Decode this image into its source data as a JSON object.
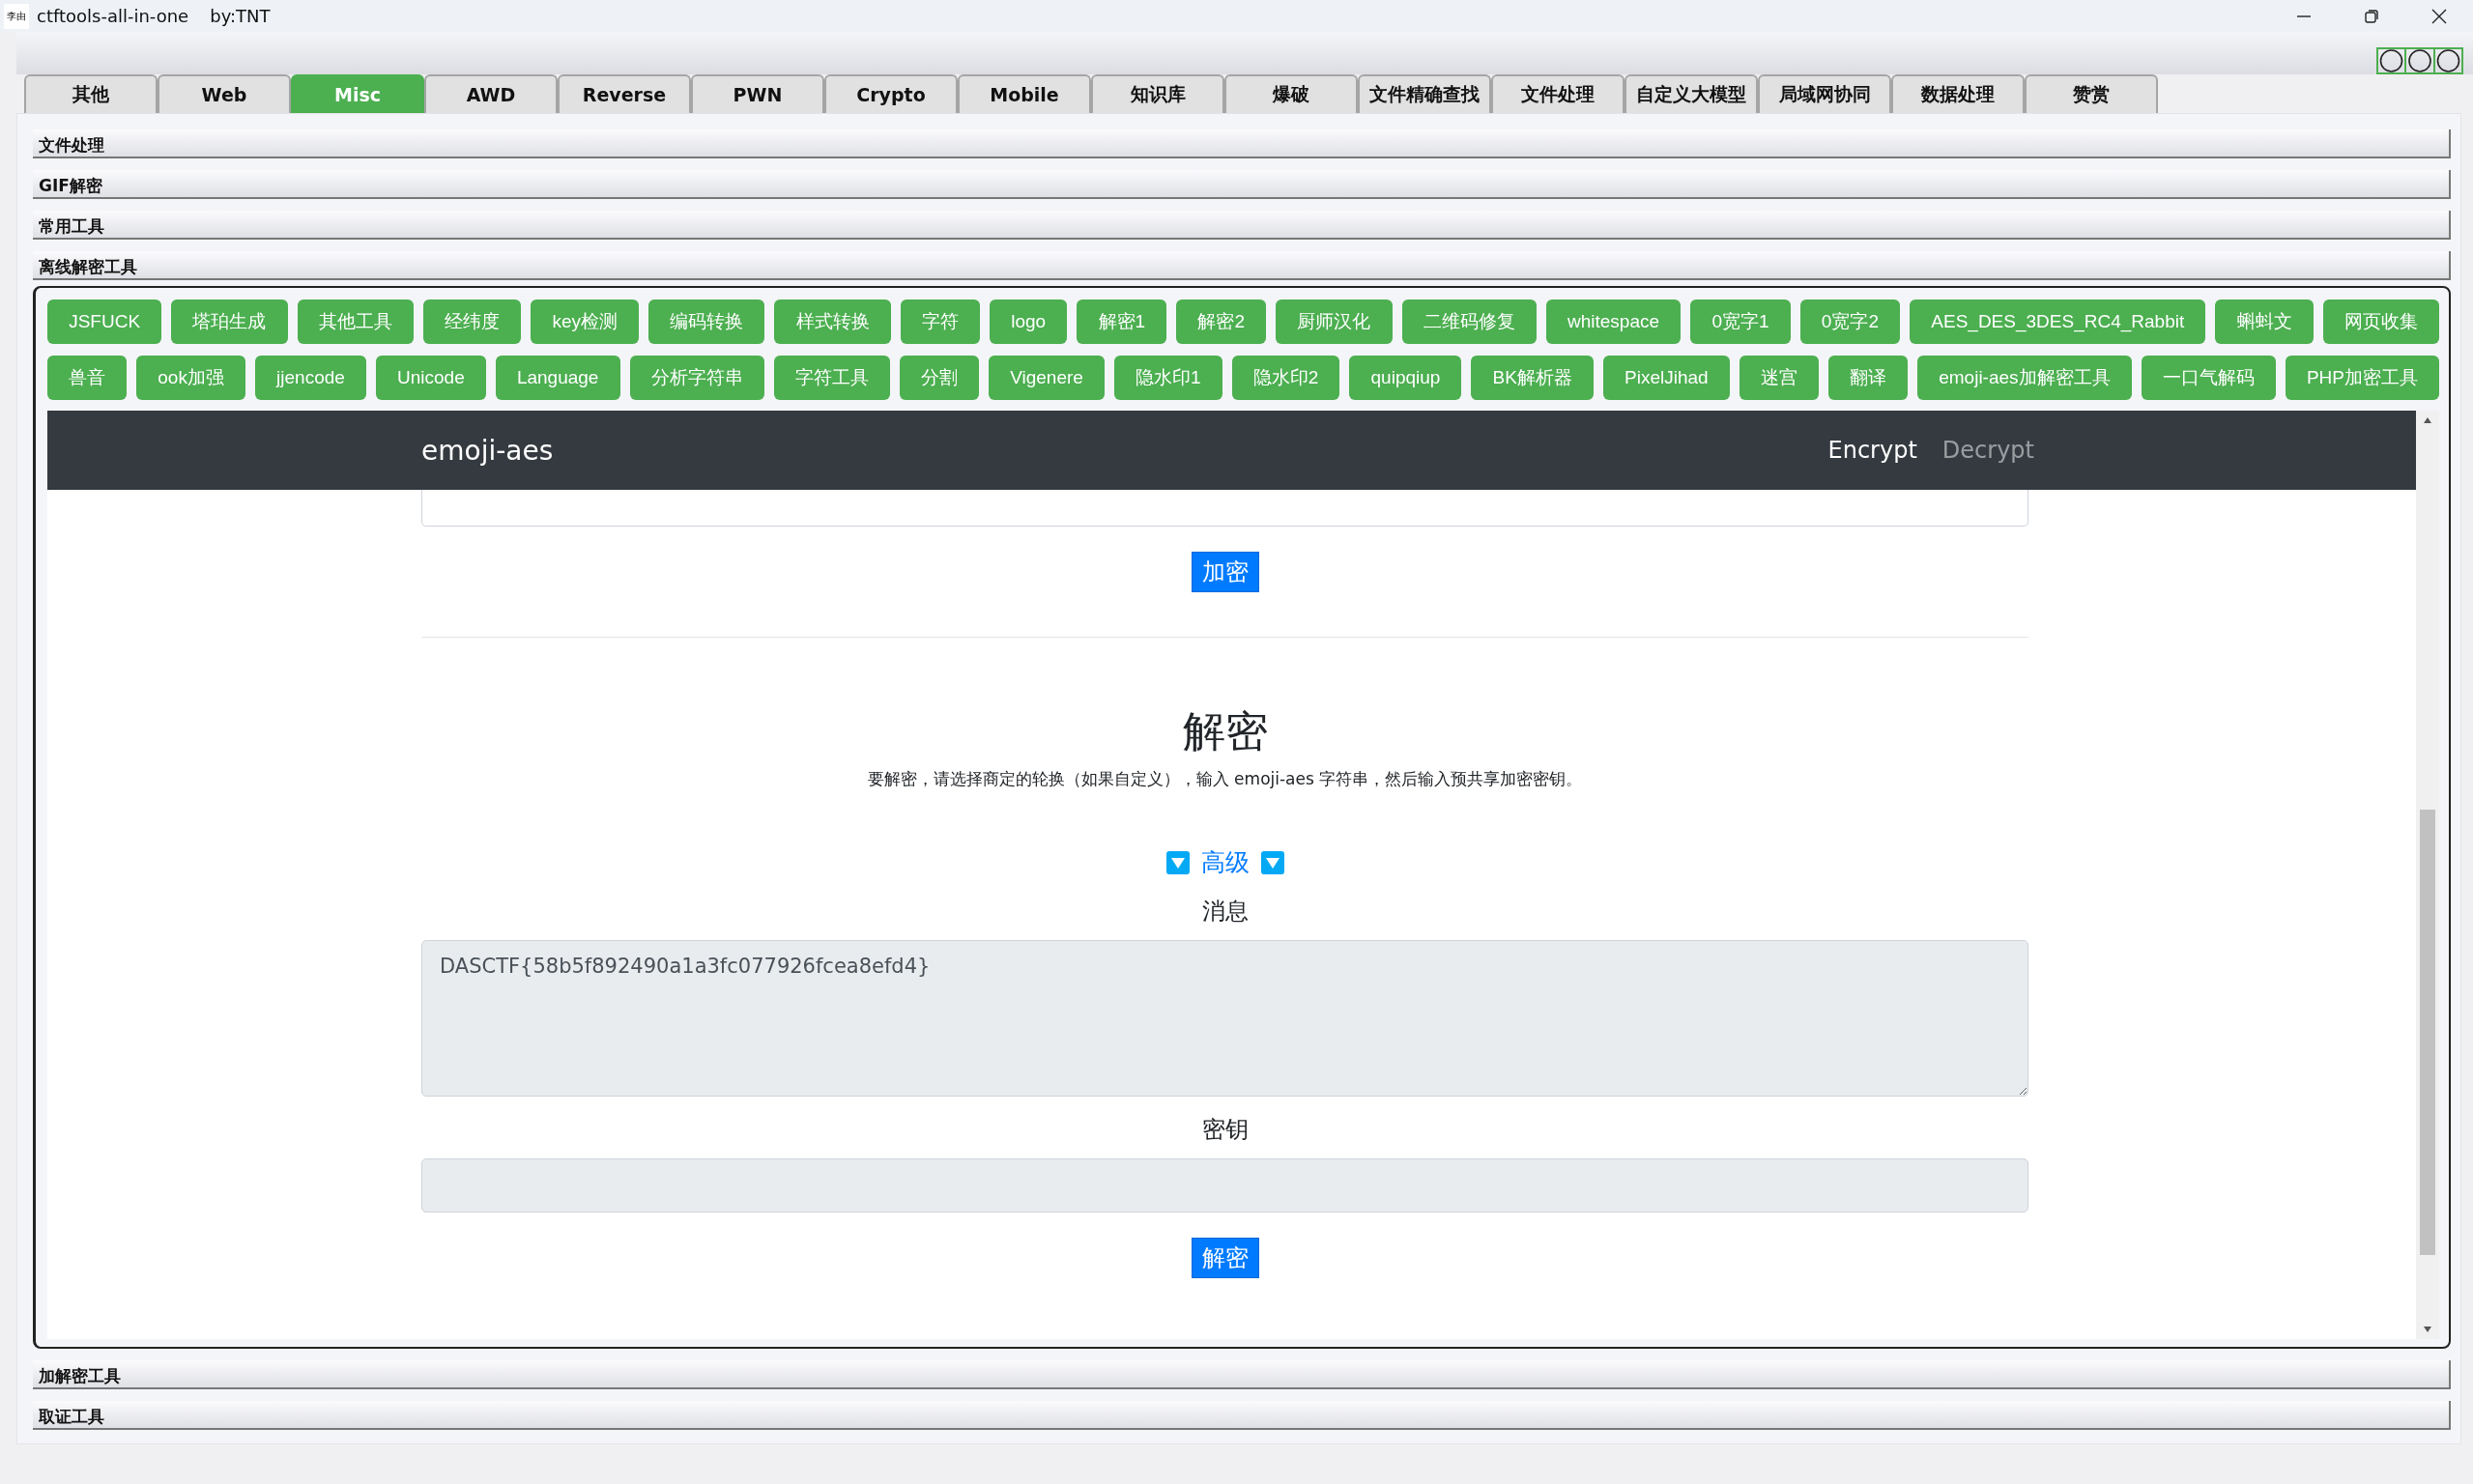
{
  "window": {
    "title": "ctftools-all-in-one",
    "subtitle": "by:TNT",
    "app_icon": "李由"
  },
  "tabs": [
    {
      "label": "其他",
      "selected": false
    },
    {
      "label": "Web",
      "selected": false
    },
    {
      "label": "Misc",
      "selected": true
    },
    {
      "label": "AWD",
      "selected": false
    },
    {
      "label": "Reverse",
      "selected": false
    },
    {
      "label": "PWN",
      "selected": false
    },
    {
      "label": "Crypto",
      "selected": false
    },
    {
      "label": "Mobile",
      "selected": false
    },
    {
      "label": "知识库",
      "selected": false
    },
    {
      "label": "爆破",
      "selected": false
    },
    {
      "label": "文件精确查找",
      "selected": false
    },
    {
      "label": "文件处理",
      "selected": false
    },
    {
      "label": "自定义大模型",
      "selected": false
    },
    {
      "label": "局域网协同",
      "selected": false
    },
    {
      "label": "数据处理",
      "selected": false
    },
    {
      "label": "赞赏",
      "selected": false
    }
  ],
  "sections_above": [
    "文件处理",
    "GIF解密",
    "常用工具",
    "离线解密工具"
  ],
  "sections_below": [
    "加解密工具",
    "取证工具"
  ],
  "tool_button_rows": [
    [
      "JSFUCK",
      "塔珀生成",
      "其他工具",
      "经纬度",
      "key检测",
      "编码转换",
      "样式转换",
      "字符",
      "logo",
      "解密1",
      "解密2",
      "厨师汉化",
      "二维码修复",
      "whitespace",
      "0宽字1",
      "0宽字2",
      "AES_DES_3DES_RC4_Rabbit",
      "蝌蚪文",
      "网页收集"
    ],
    [
      "兽音",
      "ook加强",
      "jjencode",
      "Unicode",
      "Language",
      "分析字符串",
      "字符工具",
      "分割",
      "Vigenere",
      "隐水印1",
      "隐水印2",
      "quipqiup",
      "BK解析器",
      "PixelJihad",
      "迷宫",
      "翻译",
      "emoji-aes加解密工具",
      "一口气解码",
      "PHP加密工具"
    ]
  ],
  "emoji_aes": {
    "brand": "emoji-aes",
    "nav_links": [
      {
        "label": "Encrypt",
        "selected": true
      },
      {
        "label": "Decrypt",
        "selected": false
      }
    ],
    "encrypt_button": "加密",
    "heading": "解密",
    "description": "要解密，请选择商定的轮换（如果自定义），输入 emoji-aes 字符串，然后输入预共享加密密钥。",
    "advanced": "高级",
    "message_label": "消息",
    "message_value": "DASCTF{58b5f892490a1a3fc077926fcea8efd4}",
    "key_label": "密钥",
    "decrypt_button": "解密"
  }
}
